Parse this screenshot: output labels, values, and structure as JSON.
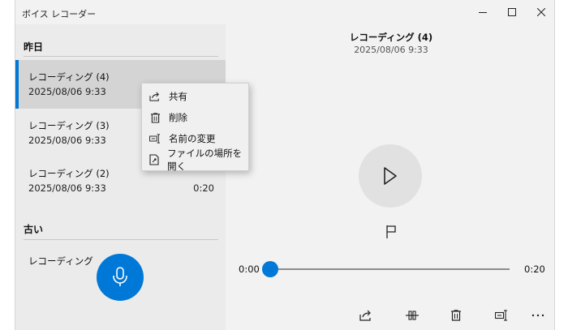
{
  "window": {
    "title": "ボイス レコーダー",
    "controls": {
      "minimize": "minimize-icon",
      "maximize": "maximize-icon",
      "close": "close-icon"
    }
  },
  "sidebar": {
    "groups": [
      {
        "header": "昨日",
        "items": [
          {
            "name": "レコーディング (4)",
            "date": "2025/08/06 9:33",
            "duration": "",
            "selected": true
          },
          {
            "name": "レコーディング (3)",
            "date": "2025/08/06 9:33",
            "duration": ""
          },
          {
            "name": "レコーディング (2)",
            "date": "2025/08/06 9:33",
            "duration": "0:20"
          }
        ]
      },
      {
        "header": "古い",
        "items": [
          {
            "name": "レコーディング",
            "date": "",
            "duration": ""
          }
        ]
      }
    ],
    "record_button": "microphone-icon"
  },
  "context_menu": {
    "items": [
      {
        "label": "共有",
        "icon": "share-icon"
      },
      {
        "label": "削除",
        "icon": "trash-icon"
      },
      {
        "label": "名前の変更",
        "icon": "rename-icon"
      },
      {
        "label": "ファイルの場所を開く",
        "icon": "open-file-location-icon"
      }
    ]
  },
  "player": {
    "title": "レコーディング (4)",
    "date": "2025/08/06 9:33",
    "current_time": "0:00",
    "total_time": "0:20",
    "progress": 0,
    "toolbar": [
      "share-icon",
      "trim-icon",
      "trash-icon",
      "rename-icon",
      "more-icon"
    ]
  },
  "colors": {
    "accent": "#0078d7",
    "selected_bg": "#d4d4d4",
    "pane_bg": "#ebebeb",
    "window_bg": "#f2f2f2"
  }
}
